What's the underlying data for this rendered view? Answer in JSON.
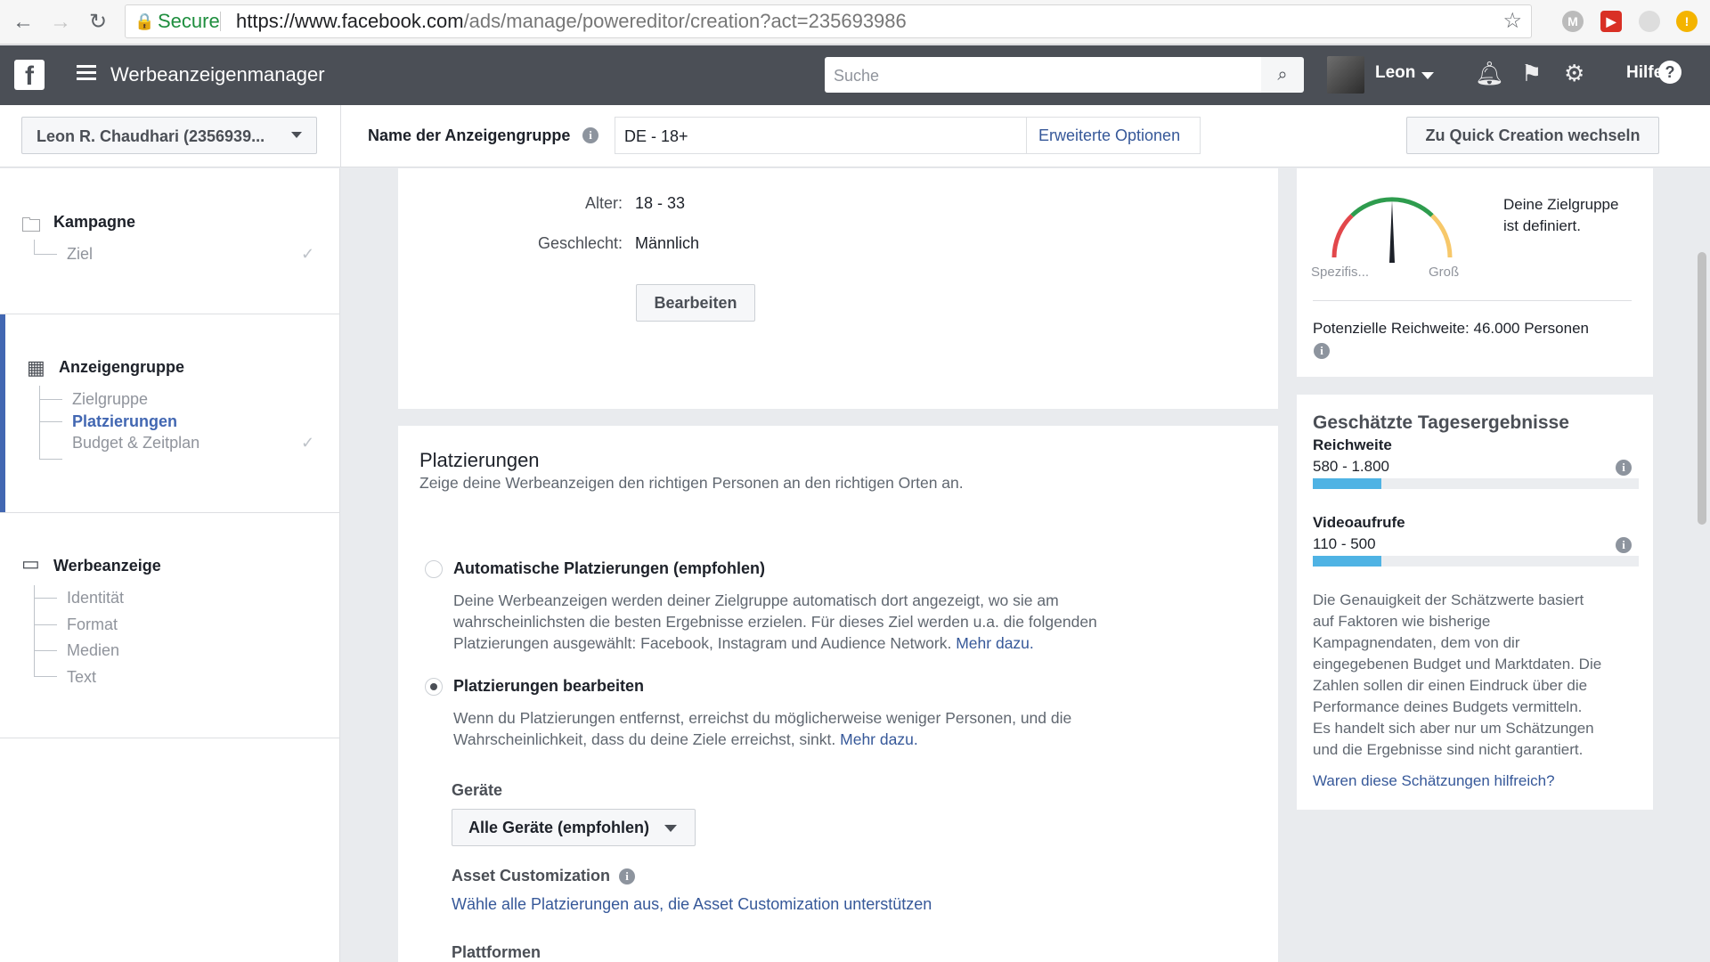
{
  "browser": {
    "secure_label": "Secure",
    "url_host": "https://www.facebook.com",
    "url_path": "/ads/manage/powereditor/creation?act=235693986"
  },
  "topbar": {
    "app_title": "Werbeanzeigenmanager",
    "search_placeholder": "Suche",
    "user_name": "Leon",
    "help_label": "Hilfe"
  },
  "header": {
    "account_selector": "Leon R. Chaudhari (2356939...",
    "adgroup_name_label": "Name der Anzeigengruppe",
    "adgroup_name_value": "DE - 18+",
    "advanced_options": "Erweiterte Optionen",
    "quick_creation_button": "Zu Quick Creation wechseln"
  },
  "sidebar": {
    "campaign": {
      "title": "Kampagne",
      "items": [
        "Ziel"
      ]
    },
    "adgroup": {
      "title": "Anzeigengruppe",
      "items": [
        "Zielgruppe",
        "Platzierungen",
        "Budget & Zeitplan"
      ],
      "active": "Platzierungen"
    },
    "ad": {
      "title": "Werbeanzeige",
      "items": [
        "Identität",
        "Format",
        "Medien",
        "Text"
      ]
    }
  },
  "audience_summary": {
    "age_label": "Alter:",
    "age_value": "18 - 33",
    "gender_label": "Geschlecht:",
    "gender_value": "Männlich",
    "edit_button": "Bearbeiten"
  },
  "placements": {
    "title": "Platzierungen",
    "subtitle": "Zeige deine Werbeanzeigen den richtigen Personen an den richtigen Orten an.",
    "auto_option": "Automatische Platzierungen (empfohlen)",
    "auto_desc_1": "Deine Werbeanzeigen werden deiner Zielgruppe automatisch dort angezeigt, wo sie am",
    "auto_desc_2": "wahrscheinlichsten die besten Ergebnisse erzielen. Für dieses Ziel werden u.a. die folgenden",
    "auto_desc_3": "Platzierungen ausgewählt: Facebook, Instagram und Audience Network.",
    "more_link": "Mehr dazu.",
    "edit_option": "Platzierungen bearbeiten",
    "edit_desc_1": "Wenn du Platzierungen entfernst, erreichst du möglicherweise weniger Personen, und die",
    "edit_desc_2": "Wahrscheinlichkeit, dass du deine Ziele erreichst, sinkt.",
    "devices_label": "Geräte",
    "devices_value": "Alle Geräte (empfohlen)",
    "asset_label": "Asset Customization",
    "asset_link": "Wähle alle Platzierungen aus, die Asset Customization unterstützen",
    "platforms_label": "Plattformen",
    "selected": "edit"
  },
  "audience_size": {
    "defined_line1": "Deine Zielgruppe",
    "defined_line2": "ist definiert.",
    "gauge_left": "Spezifis...",
    "gauge_right": "Groß",
    "reach": "Potenzielle Reichweite: 46.000 Personen"
  },
  "estimates": {
    "title": "Geschätzte Tagesergebnisse",
    "reach_label": "Reichweite",
    "reach_value": "580 - 1.800",
    "reach_fraction": 0.21,
    "views_label": "Videoaufrufe",
    "views_value": "110 - 500",
    "views_fraction": 0.21,
    "note": [
      "Die Genauigkeit der Schätzwerte basiert",
      "auf Faktoren wie bisherige",
      "Kampagnendaten, dem von dir",
      "eingegebenen Budget und Marktdaten. Die",
      "Zahlen sollen dir einen Eindruck über die",
      "Performance deines Budgets vermitteln.",
      "Es handelt sich aber nur um Schätzungen",
      "und die Ergebnisse sind nicht garantiert."
    ],
    "feedback_link": "Waren diese Schätzungen hilfreich?"
  },
  "colors": {
    "accent": "#4267b2",
    "link": "#365899",
    "bar": "#4fb3e4",
    "topbar": "#4b4f56"
  }
}
